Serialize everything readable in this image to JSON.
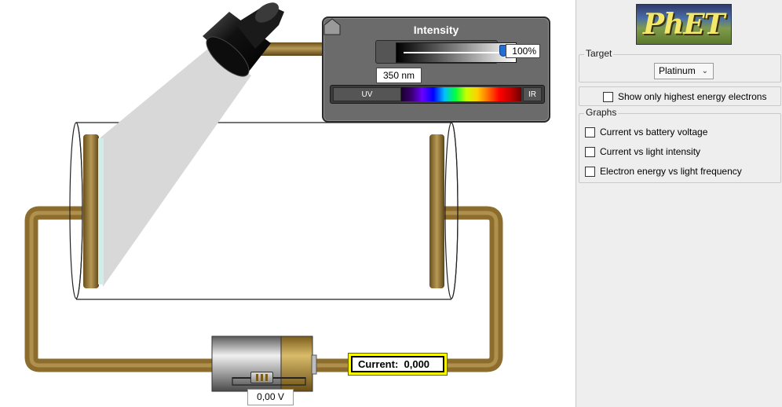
{
  "light_panel": {
    "title": "Intensity",
    "intensity_value": "100%",
    "intensity_level": 1.0,
    "wavelength_value": "350 nm",
    "uv_label": "UV",
    "ir_label": "IR"
  },
  "circuit": {
    "voltage_value": "0,00 V",
    "current_text": "Current:  0,000"
  },
  "side_panel": {
    "logo_text": "PhET",
    "target": {
      "title": "Target",
      "selected": "Platinum"
    },
    "show_highest_energy": {
      "label": "Show only highest energy electrons",
      "checked": false
    },
    "graphs": {
      "title": "Graphs",
      "items": [
        {
          "label": "Current vs battery voltage",
          "checked": false
        },
        {
          "label": "Current vs light intensity",
          "checked": false
        },
        {
          "label": "Electron energy vs light frequency",
          "checked": false
        }
      ]
    }
  },
  "colors": {
    "wire": "#8c6d2e",
    "current_box": "#ffff00",
    "intensity_knob": "#1f6fd6",
    "panel_bg": "#6b6b6b"
  }
}
